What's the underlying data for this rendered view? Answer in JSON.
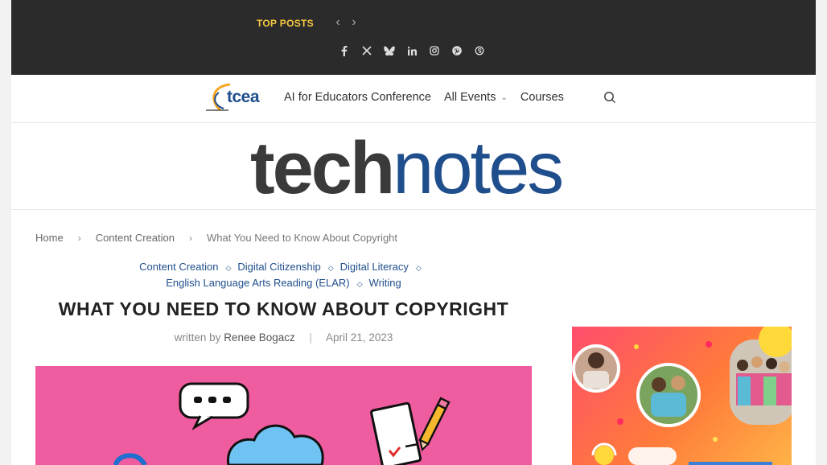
{
  "topbar": {
    "top_posts_label": "TOP POSTS",
    "prev_icon": "chevron-left-icon",
    "next_icon": "chevron-right-icon",
    "socials": [
      {
        "name": "facebook-icon",
        "glyph": "f"
      },
      {
        "name": "x-icon",
        "glyph": "𝕏"
      },
      {
        "name": "bluesky-icon",
        "glyph": "🦋"
      },
      {
        "name": "linkedin-icon",
        "glyph": "in"
      },
      {
        "name": "instagram-icon",
        "glyph": "◎"
      },
      {
        "name": "pinterest-icon",
        "glyph": "P"
      },
      {
        "name": "threads-icon",
        "glyph": "@"
      }
    ]
  },
  "nav": {
    "logo_text": "tcea",
    "items": [
      "AI for Educators Conference",
      "All Events",
      "Courses"
    ],
    "search_icon": "search-icon"
  },
  "header": {
    "brand_tech": "tech",
    "brand_notes": "notes"
  },
  "breadcrumb": {
    "home": "Home",
    "category": "Content Creation",
    "current": "What You Need to Know About Copyright"
  },
  "article": {
    "categories": [
      "Content Creation",
      "Digital Citizenship",
      "Digital Literacy",
      "English Language Arts Reading (ELAR)",
      "Writing"
    ],
    "title": "WHAT YOU NEED TO KNOW ABOUT COPYRIGHT",
    "written_by": "written by",
    "author": "Renee Bogacz",
    "date": "April 21, 2023"
  },
  "colors": {
    "topbar": "#2b2b2b",
    "accent": "#1f4e8c",
    "top_posts": "#f5c842",
    "hero_bg": "#f05ca0"
  }
}
